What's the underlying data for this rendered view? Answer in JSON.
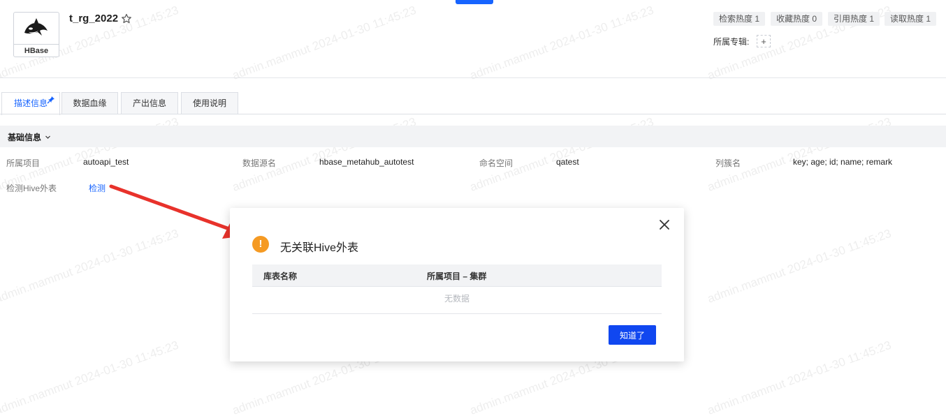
{
  "header": {
    "logo_label": "HBase",
    "title": "t_rg_2022",
    "stats": [
      {
        "label": "检索热度 1"
      },
      {
        "label": "收藏热度 0"
      },
      {
        "label": "引用热度 1"
      },
      {
        "label": "读取热度 1"
      }
    ],
    "topic_label": "所属专辑:",
    "topic_add": "+"
  },
  "tabs": [
    {
      "label": "描述信息",
      "active": true
    },
    {
      "label": "数据血缘",
      "active": false
    },
    {
      "label": "产出信息",
      "active": false
    },
    {
      "label": "使用说明",
      "active": false
    }
  ],
  "section": {
    "title": "基础信息",
    "fields": [
      {
        "key": "所属项目",
        "value": "autoapi_test"
      },
      {
        "key": "数据源名",
        "value": "hbase_metahub_autotest"
      },
      {
        "key": "命名空间",
        "value": "qatest"
      },
      {
        "key": "列簇名",
        "value": "key; age; id; name; remark"
      }
    ],
    "detect": {
      "key": "检测Hive外表",
      "link": "检测"
    }
  },
  "dialog": {
    "title": "无关联Hive外表",
    "columns": [
      "库表名称",
      "所属项目 – 集群"
    ],
    "empty_text": "无数据",
    "ok_label": "知道了"
  },
  "watermark": "admin.mammut 2024-01-30 11:45:23",
  "colors": {
    "accent": "#1764ff",
    "button": "#1047f0",
    "warning": "#f59a23",
    "arrow": "#e8322b"
  }
}
